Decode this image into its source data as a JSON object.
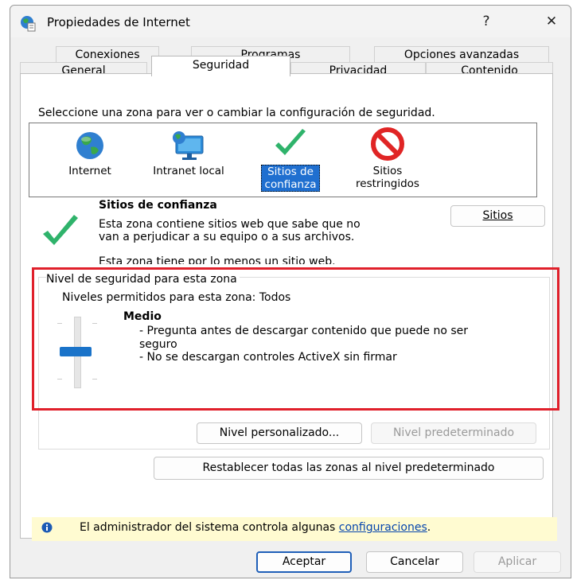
{
  "window": {
    "title": "Propiedades de Internet",
    "help_label": "?",
    "close_label": "✕"
  },
  "tabs": {
    "row1": [
      "Conexiones",
      "Programas",
      "Opciones avanzadas"
    ],
    "row2": [
      "General",
      "Seguridad",
      "Privacidad",
      "Contenido"
    ],
    "active": "Seguridad"
  },
  "security": {
    "instruction": "Seleccione una zona para ver o cambiar la configuración de seguridad.",
    "zones": [
      {
        "line1": "Internet",
        "line2": "",
        "icon": "globe-icon"
      },
      {
        "line1": "Intranet local",
        "line2": "",
        "icon": "intranet-monitor-icon"
      },
      {
        "line1": "Sitios de",
        "line2": "confianza",
        "icon": "trusted-checkmark-icon",
        "selected": true
      },
      {
        "line1": "Sitios",
        "line2": "restringidos",
        "icon": "restricted-icon"
      }
    ],
    "zone_title": "Sitios de confianza",
    "zone_desc_line1": "Esta zona contiene sitios web que sabe que no",
    "zone_desc_line2": "van a perjudicar a su equipo o a sus archivos.",
    "zone_note": "Esta zona tiene por lo menos un sitio web.",
    "sites_button": "Sitios",
    "level_group_label": "Nivel de seguridad para esta zona",
    "allowed_levels": "Niveles permitidos para esta zona: Todos",
    "level_name": "Medio",
    "level_desc_line1": "- Pregunta antes de descargar contenido que puede no ser",
    "level_desc_line2": "seguro",
    "level_desc_line3": "- No se descargan controles ActiveX sin firmar",
    "slider_level": 0.5,
    "custom_level_button": "Nivel personalizado...",
    "default_level_button": "Nivel predeterminado",
    "reset_all_button": "Restablecer todas las zonas al nivel predeterminado",
    "admin_notice_text": "El administrador del sistema controla algunas",
    "admin_notice_link": "configuraciones",
    "admin_notice_end": "."
  },
  "footer": {
    "ok": "Aceptar",
    "cancel": "Cancelar",
    "apply": "Aplicar"
  },
  "colors": {
    "selection": "#1f6fd0",
    "highlight_box": "#e0202b",
    "check_green": "#2fb36b",
    "notice_bg": "#fffbd1"
  }
}
